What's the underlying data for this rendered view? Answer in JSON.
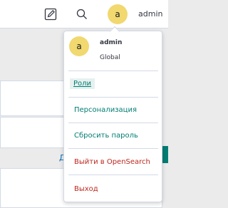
{
  "header": {
    "avatar_initial": "a",
    "username": "admin",
    "new_icon": "new-document-icon",
    "search_icon": "search-icon"
  },
  "menu": {
    "avatar_initial": "a",
    "username": "admin",
    "tenant": "Global",
    "items": [
      {
        "label": "Роли",
        "color": "#017d73"
      },
      {
        "label": "Персонализация",
        "color": "#017d73"
      },
      {
        "label": "Сбросить пароль",
        "color": "#017d73"
      },
      {
        "label": "Выйти в OpenSearch",
        "color": "#bd271e"
      },
      {
        "label": "Выход",
        "color": "#bd271e"
      }
    ]
  },
  "background": {
    "partial_link": "Д"
  }
}
